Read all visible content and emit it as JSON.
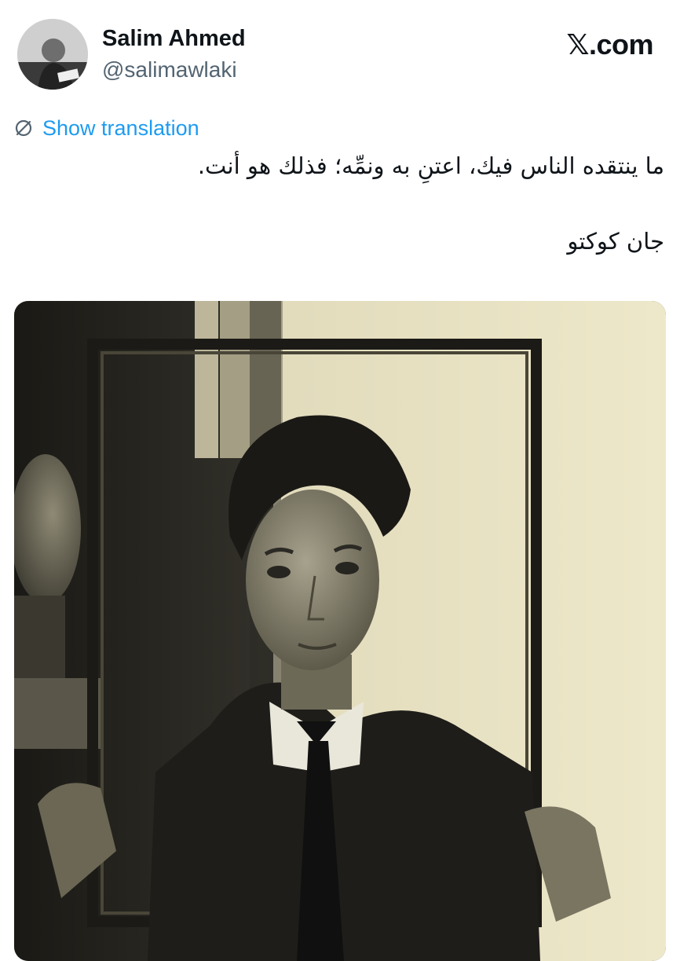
{
  "author": {
    "name": "Salim Ahmed",
    "handle": "@salimawlaki",
    "avatar_icon": "profile-photo"
  },
  "site": {
    "label": "𝕏.com"
  },
  "translate": {
    "icon": "translate-icon",
    "label": "Show translation"
  },
  "tweet": {
    "lines": [
      "ما ينتقده الناس فيك، اعتنِ به ونمِّه؛ فذلك هو أنت.",
      "جان كوكتو"
    ]
  },
  "media": {
    "type": "photo",
    "palette": {
      "paper": "#e7e1c2",
      "dark": "#1d1c17",
      "mid": "#5d5a4b",
      "skin": "#8a8573"
    }
  },
  "colors": {
    "text": "#0f1419",
    "muted": "#536471",
    "link": "#1d9bf0",
    "background": "#ffffff"
  }
}
